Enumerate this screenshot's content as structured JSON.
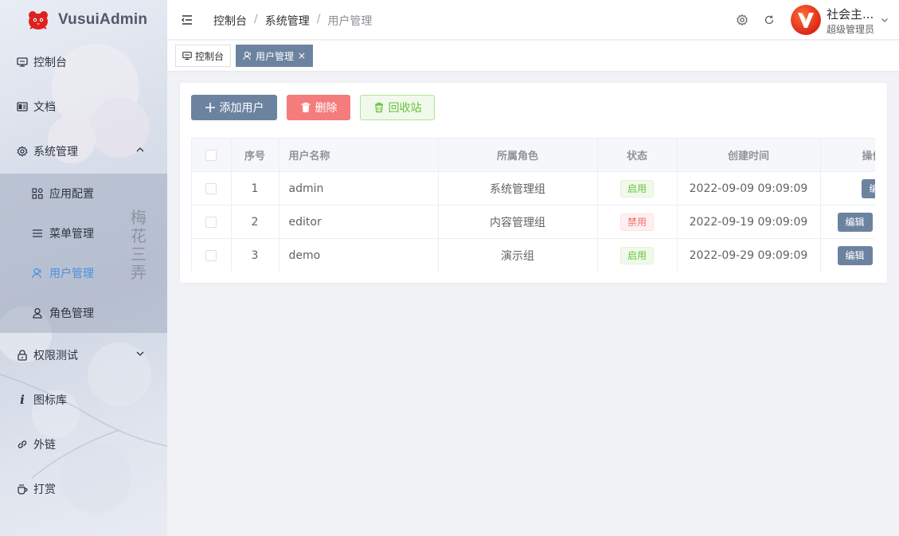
{
  "app": {
    "title": "VusuiAdmin"
  },
  "sidebar": {
    "items": [
      {
        "label": "控制台",
        "icon": "monitor-icon"
      },
      {
        "label": "文档",
        "icon": "document-icon"
      },
      {
        "label": "系统管理",
        "icon": "gear-icon",
        "expanded": true
      },
      {
        "label": "权限测试",
        "icon": "lock-icon",
        "expanded": false
      },
      {
        "label": "图标库",
        "icon": "info-icon"
      },
      {
        "label": "外链",
        "icon": "link-icon"
      },
      {
        "label": "打赏",
        "icon": "coffee-icon"
      }
    ],
    "subitems": [
      {
        "label": "应用配置",
        "icon": "grid-icon"
      },
      {
        "label": "菜单管理",
        "icon": "list-icon"
      },
      {
        "label": "用户管理",
        "icon": "user-icon",
        "active": true
      },
      {
        "label": "角色管理",
        "icon": "user-icon"
      }
    ],
    "vertical_text": "梅花三弄"
  },
  "header": {
    "breadcrumb": [
      "控制台",
      "系统管理",
      "用户管理"
    ],
    "user_name": "社会主...",
    "user_role": "超级管理员"
  },
  "tags": [
    {
      "label": "控制台",
      "icon": "monitor-icon",
      "active": false
    },
    {
      "label": "用户管理",
      "icon": "user-icon",
      "active": true,
      "close": "×"
    }
  ],
  "toolbar": {
    "add_label": "添加用户",
    "delete_label": "删除",
    "recycle_label": "回收站"
  },
  "table": {
    "headers": [
      "序号",
      "用户名称",
      "所属角色",
      "状态",
      "创建时间",
      "操作"
    ],
    "rows": [
      {
        "index": "1",
        "name": "admin",
        "role": "系统管理组",
        "status": "启用",
        "status_on": true,
        "created": "2022-09-09 09:09:09",
        "action": "编辑"
      },
      {
        "index": "2",
        "name": "editor",
        "role": "内容管理组",
        "status": "禁用",
        "status_on": false,
        "created": "2022-09-19 09:09:09",
        "action": "编辑"
      },
      {
        "index": "3",
        "name": "demo",
        "role": "演示组",
        "status": "启用",
        "status_on": true,
        "created": "2022-09-29 09:09:09",
        "action": "编辑"
      }
    ]
  },
  "colors": {
    "accent": "#6c83a0",
    "active_menu": "#4a90e2",
    "danger": "#f47c7c",
    "success": "#67c23a"
  }
}
